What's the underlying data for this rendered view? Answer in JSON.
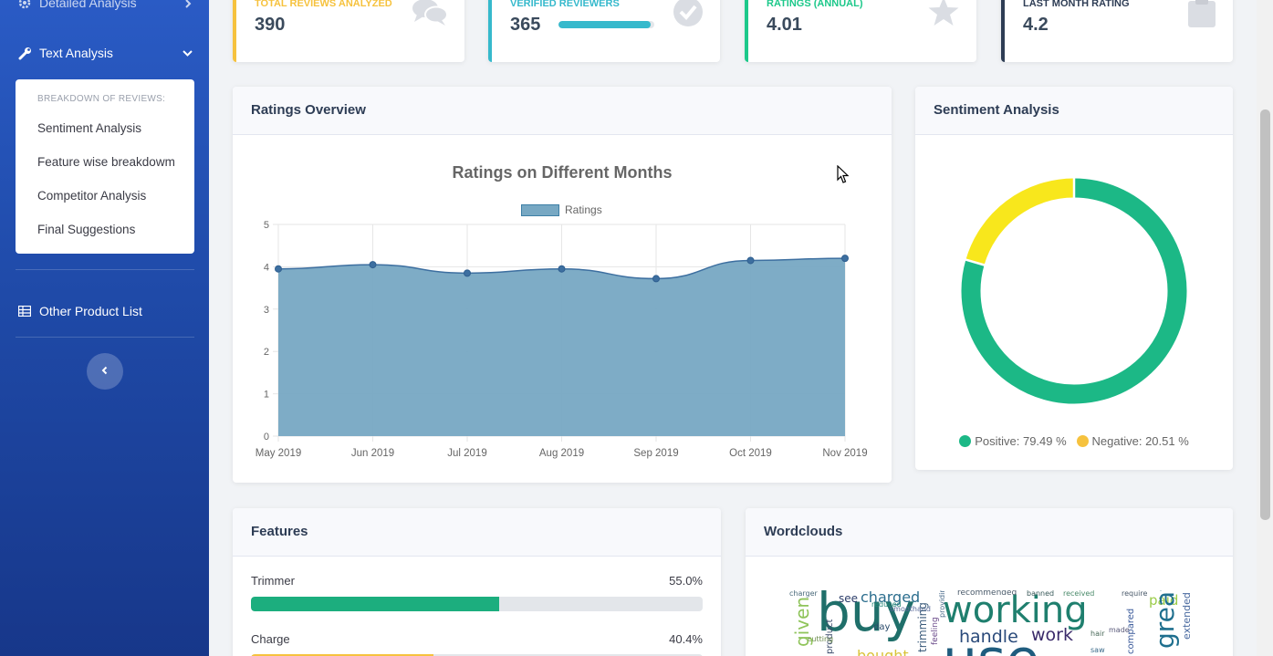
{
  "sidebar": {
    "items": [
      {
        "label": "Detailed Analysis",
        "icon": "gear-icon"
      },
      {
        "label": "Text Analysis",
        "icon": "wrench-icon"
      },
      {
        "label": "Other Product List",
        "icon": "table-icon"
      }
    ],
    "submenu": {
      "header": "BREAKDOWN OF REVIEWS:",
      "items": [
        "Sentiment Analysis",
        "Feature wise breakdowm",
        "Competitor Analysis",
        "Final Suggestions"
      ]
    }
  },
  "stats": [
    {
      "label": "TOTAL REVIEWS ANALYZED",
      "value": "390",
      "color": "#f6c23e",
      "icon": "comments-icon"
    },
    {
      "label": "VERIFIED REVIEWERS",
      "value": "365",
      "color": "#36b9cc",
      "icon": "check-circle-icon",
      "progress": 0.96
    },
    {
      "label": "RATINGS (ANNUAL)",
      "value": "4.01",
      "color": "#1cc88a",
      "icon": "star-icon"
    },
    {
      "label": "LAST MONTH RATING",
      "value": "4.2",
      "color": "#2e3d55",
      "icon": "clipboard-icon"
    }
  ],
  "ratings_card": {
    "title": "Ratings Overview"
  },
  "sentiment_card": {
    "title": "Sentiment Analysis",
    "positive_label": "Positive: 79.49 %",
    "negative_label": "Negative: 20.51 %"
  },
  "features_card": {
    "title": "Features",
    "items": [
      {
        "name": "Trimmer",
        "pct_label": "55.0%",
        "value": 55.0,
        "color": "#1cae7e"
      },
      {
        "name": "Charge",
        "pct_label": "40.4%",
        "value": 40.4,
        "color": "#f6c23e"
      }
    ]
  },
  "wordcloud_card": {
    "title": "Wordclouds",
    "words": [
      "buy",
      "working",
      "handle",
      "work",
      "charged",
      "given",
      "see",
      "recommended",
      "paid",
      "charger",
      "extended",
      "compared",
      "great",
      "use",
      "require",
      "received",
      "banned",
      "smoothand",
      "reduced",
      "product",
      "trimming",
      "feeling",
      "day",
      "providing",
      "cutting",
      "bought",
      "hair",
      "made",
      "saw"
    ]
  },
  "chart_data": [
    {
      "type": "area",
      "title": "Ratings on Different Months",
      "x": [
        "May 2019",
        "Jun 2019",
        "Jul 2019",
        "Aug 2019",
        "Sep 2019",
        "Oct 2019",
        "Nov 2019"
      ],
      "series": [
        {
          "name": "Ratings",
          "values": [
            3.95,
            4.05,
            3.85,
            3.95,
            3.72,
            4.15,
            4.2
          ]
        }
      ],
      "yticks": [
        "0",
        "1",
        "2",
        "3",
        "4",
        "5"
      ],
      "ylim": [
        0,
        5
      ],
      "grid": true,
      "legend": "top",
      "fill_color": "#77a8c3",
      "line_color": "#3d6fa0"
    },
    {
      "type": "pie",
      "variant": "doughnut",
      "labels": [
        "Positive",
        "Negative"
      ],
      "values": [
        79.49,
        20.51
      ],
      "colors": [
        "#1cb886",
        "#f8e71c"
      ]
    }
  ]
}
